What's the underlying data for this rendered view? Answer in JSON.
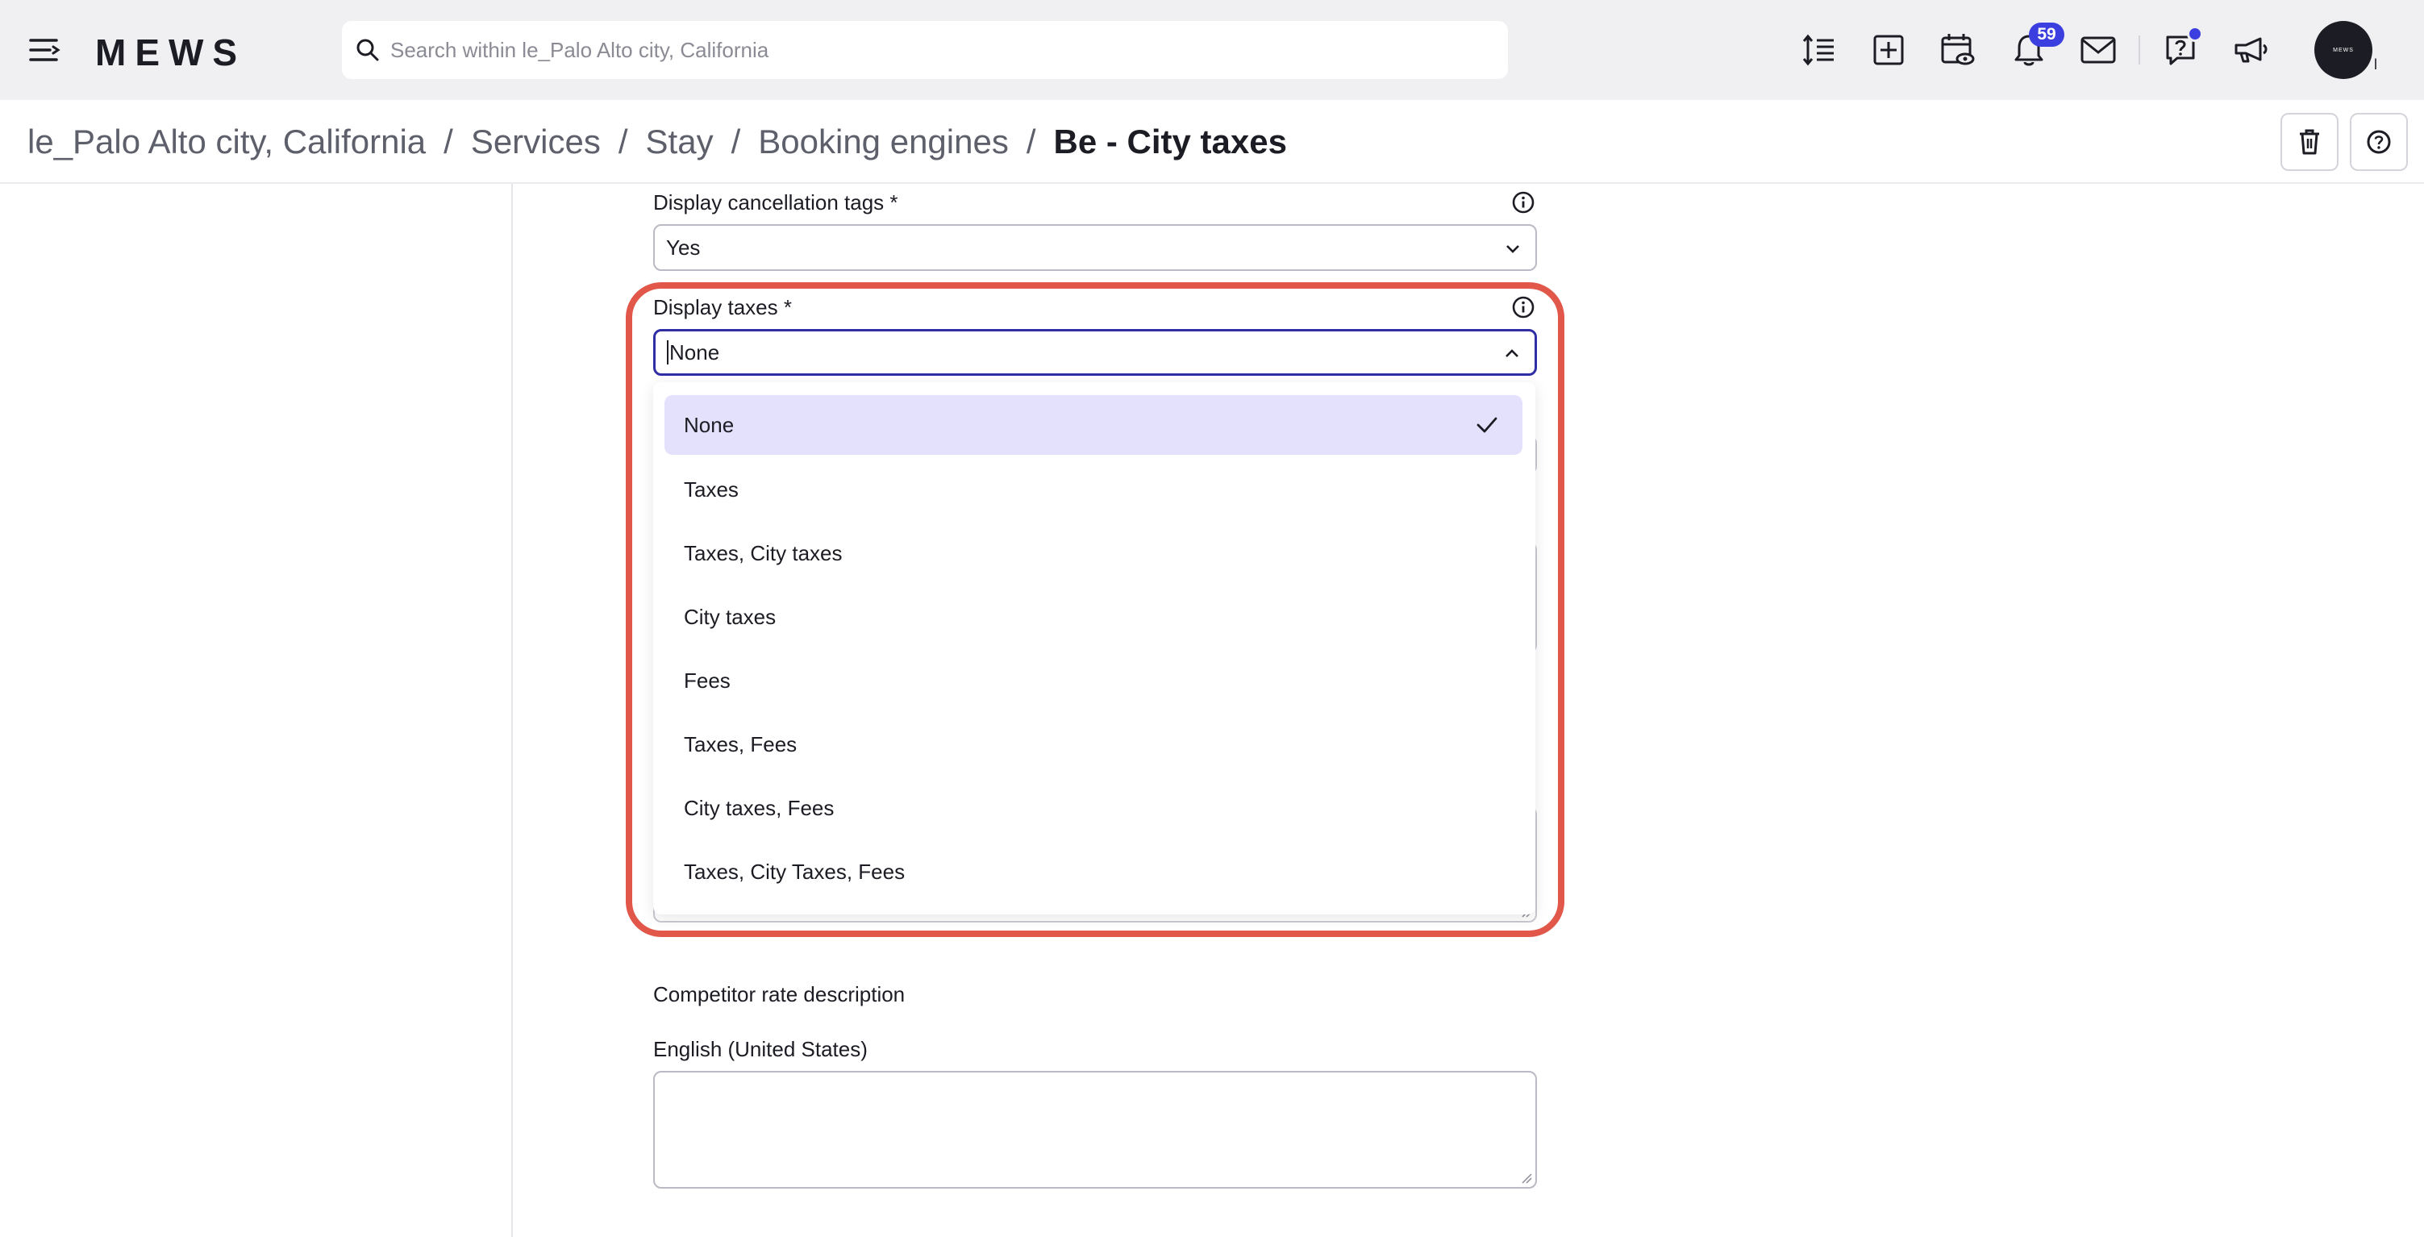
{
  "topbar": {
    "logo": "MEWS",
    "search_placeholder": "Search within le_Palo Alto city, California",
    "notification_count": "59",
    "avatar_text": "MEWS",
    "avatar_caret": "l"
  },
  "breadcrumb": {
    "items": [
      "le_Palo Alto city, California",
      "Services",
      "Stay",
      "Booking engines"
    ],
    "current": "Be - City taxes",
    "separator": "/"
  },
  "form": {
    "cancellation_tags": {
      "label": "Display cancellation tags *",
      "value": "Yes"
    },
    "display_taxes": {
      "label": "Display taxes *",
      "value": "None",
      "options": [
        "None",
        "Taxes",
        "Taxes, City taxes",
        "City taxes",
        "Fees",
        "Taxes, Fees",
        "City taxes, Fees",
        "Taxes, City Taxes, Fees"
      ],
      "selected_index": 0
    },
    "competitor": {
      "section_label": "Competitor rate description",
      "language_label": "English (United States)",
      "value": ""
    }
  },
  "colors": {
    "highlight": "#e1574a",
    "accent": "#3c3fe0",
    "selected_option_bg": "#e3e1fb",
    "focus_border": "#2f2ea4"
  }
}
